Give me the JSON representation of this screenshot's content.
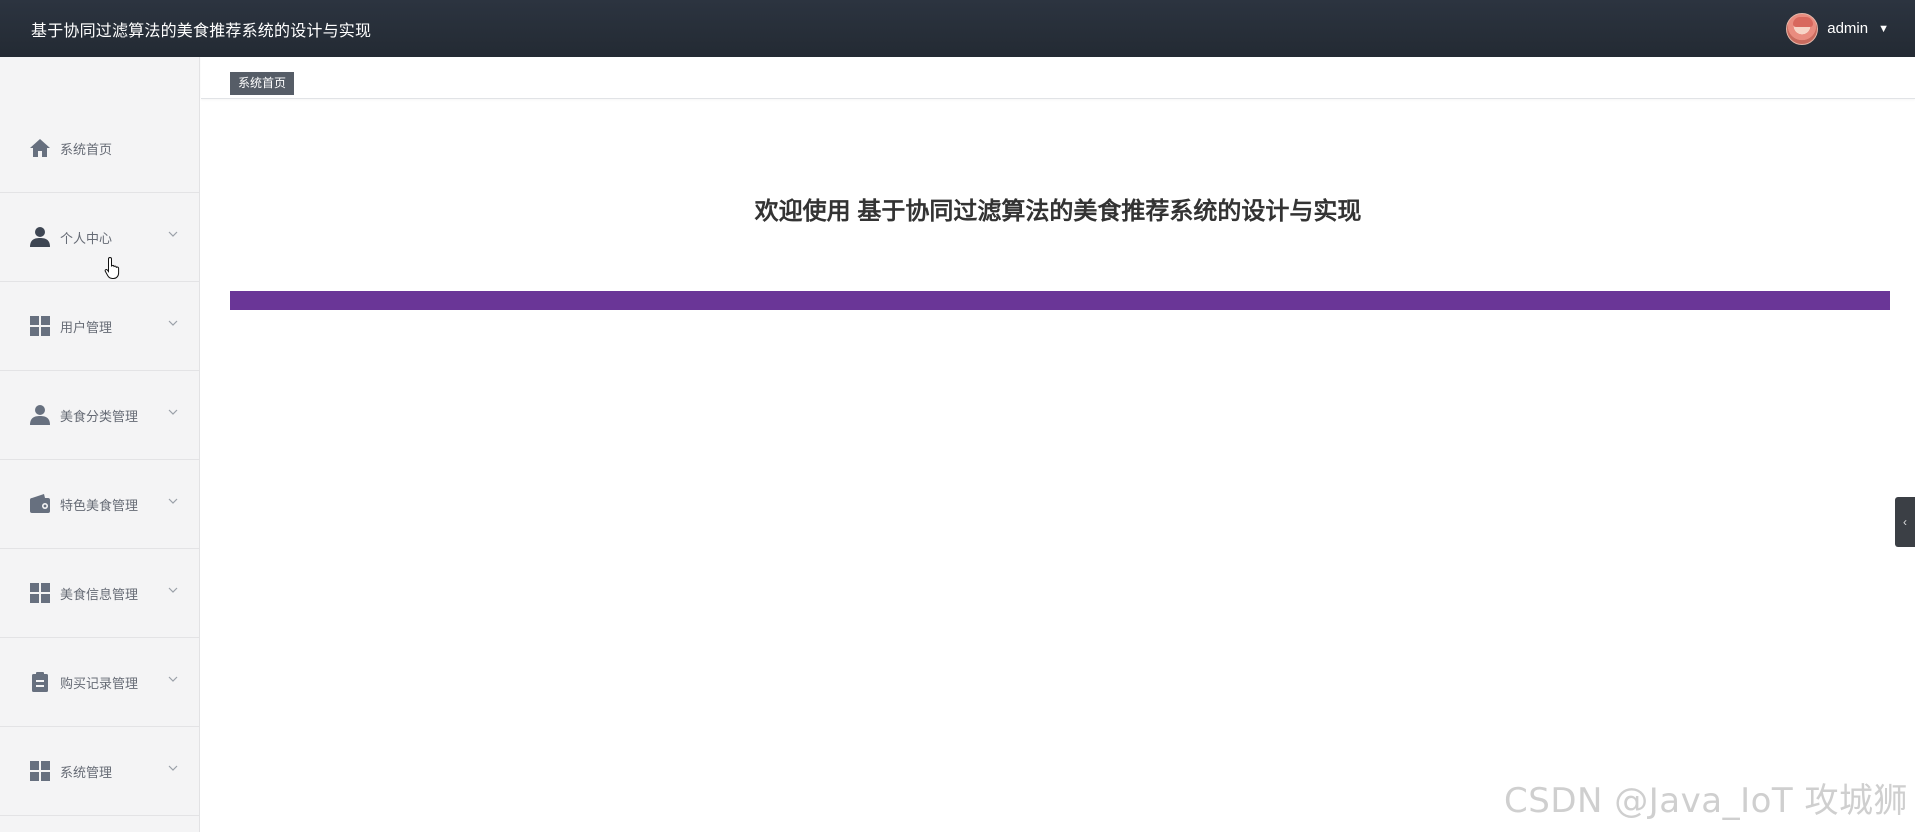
{
  "header": {
    "app_title": "基于协同过滤算法的美食推荐系统的设计与实现",
    "user": {
      "name": "admin",
      "avatar_icon": "avatar-icon",
      "caret_icon": "caret-down-icon"
    }
  },
  "sidebar": {
    "items": [
      {
        "label": "系统首页",
        "icon": "home-icon",
        "expandable": false
      },
      {
        "label": "个人中心",
        "icon": "user-icon",
        "expandable": true
      },
      {
        "label": "用户管理",
        "icon": "grid-icon",
        "expandable": true
      },
      {
        "label": "美食分类管理",
        "icon": "person-icon",
        "expandable": true
      },
      {
        "label": "特色美食管理",
        "icon": "wallet-icon",
        "expandable": true
      },
      {
        "label": "美食信息管理",
        "icon": "grid-icon",
        "expandable": true
      },
      {
        "label": "购买记录管理",
        "icon": "clipboard-icon",
        "expandable": true
      },
      {
        "label": "系统管理",
        "icon": "grid-icon",
        "expandable": true
      }
    ]
  },
  "tabs": [
    {
      "label": "系统首页",
      "active": true
    }
  ],
  "main": {
    "welcome_text": "欢迎使用 基于协同过滤算法的美食推荐系统的设计与实现",
    "accent_color": "#6a3697"
  },
  "watermark": "CSDN @Java_IoT 攻城狮",
  "colors": {
    "header_bg": "#2c3440",
    "sidebar_bg": "#f4f4f5",
    "icon_color": "#67707f",
    "tab_active_bg": "#565d67"
  }
}
